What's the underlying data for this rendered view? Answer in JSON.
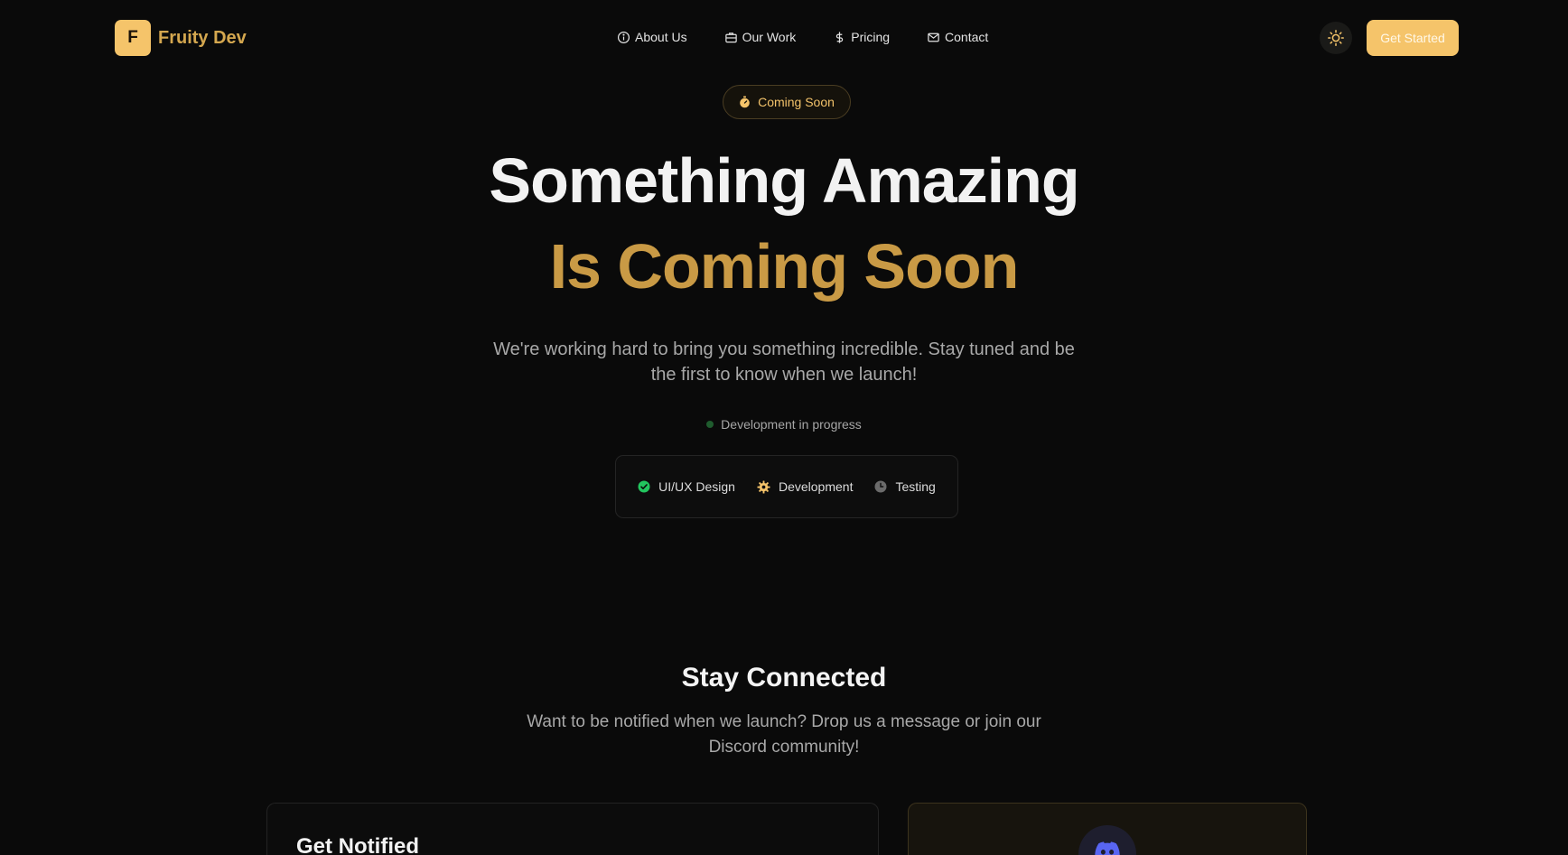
{
  "header": {
    "logo_letter": "F",
    "brand": "Fruity Dev",
    "nav": [
      {
        "label": "About Us",
        "icon": "info-icon"
      },
      {
        "label": "Our Work",
        "icon": "briefcase-icon"
      },
      {
        "label": "Pricing",
        "icon": "dollar-icon"
      },
      {
        "label": "Contact",
        "icon": "mail-icon"
      }
    ],
    "theme_toggle_icon": "sun-icon",
    "cta_label": "Get Started"
  },
  "hero": {
    "badge": "Coming Soon",
    "badge_icon": "stopwatch-icon",
    "title_line1": "Something Amazing",
    "title_line2": "Is Coming Soon",
    "subtitle": "We're working hard to bring you something incredible. Stay tuned and be the first to know when we launch!",
    "status": "Development in progress",
    "steps": [
      {
        "label": "UI/UX Design",
        "icon": "check-circle-icon",
        "state": "done"
      },
      {
        "label": "Development",
        "icon": "gear-icon",
        "state": "in-progress"
      },
      {
        "label": "Testing",
        "icon": "clock-icon",
        "state": "pending"
      }
    ]
  },
  "connect": {
    "title": "Stay Connected",
    "subtitle": "Want to be notified when we launch? Drop us a message or join our Discord community!",
    "notify_card_title": "Get Notified",
    "discord_icon": "discord-icon"
  },
  "colors": {
    "background": "#0a0a0a",
    "accent": "#f5c46a",
    "accent_dark": "#c99a45",
    "success": "#22c55e",
    "discord": "#5865f2"
  }
}
